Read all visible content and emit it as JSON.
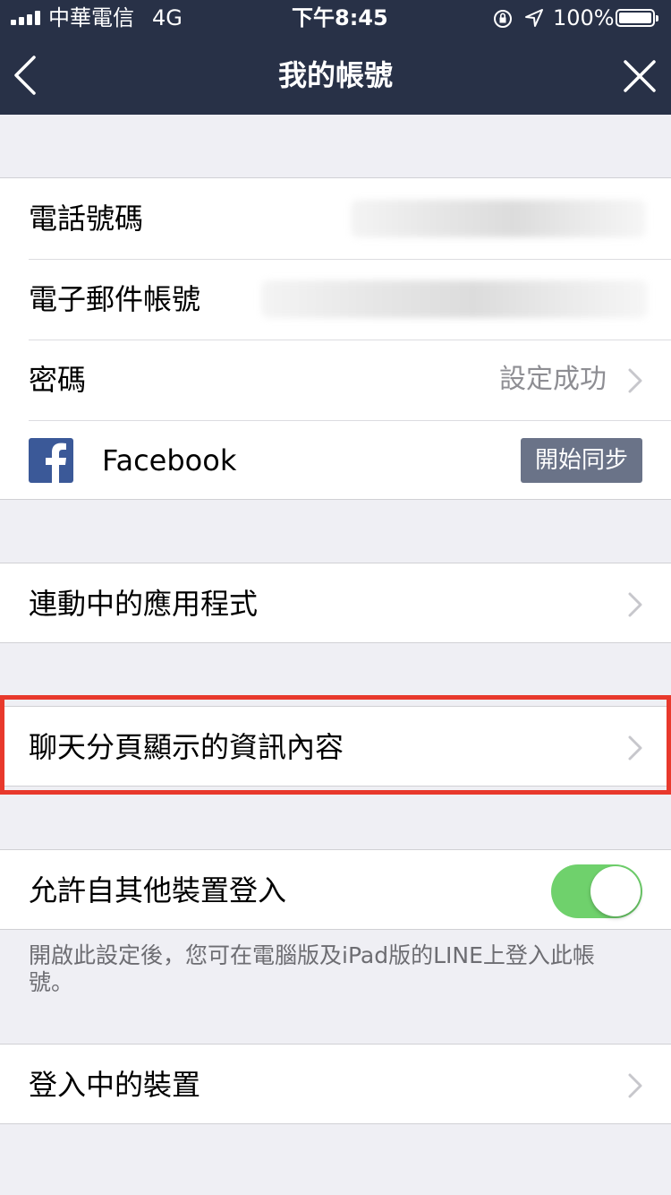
{
  "status_bar": {
    "carrier": "中華電信",
    "network": "4G",
    "time": "下午8:45",
    "battery": "100%",
    "battery_level_percent": 100,
    "icons": [
      "signal-icon",
      "orientation-lock-icon",
      "location-icon",
      "battery-icon"
    ]
  },
  "nav": {
    "title": "我的帳號",
    "back_icon": "chevron-left-icon",
    "close_icon": "close-icon"
  },
  "account": {
    "phone_label": "電話號碼",
    "email_label": "電子郵件帳號",
    "password_label": "密碼",
    "password_value": "設定成功",
    "facebook_label": "Facebook",
    "facebook_icon": "facebook-icon",
    "facebook_button": "開始同步"
  },
  "linked_apps": {
    "label": "連動中的應用程式"
  },
  "chat_tab_info": {
    "label": "聊天分頁顯示的資訊內容",
    "highlight_color": "#e8392c"
  },
  "other_devices": {
    "label": "允許自其他裝置登入",
    "toggle_on": true,
    "note": "開啟此設定後，您可在電腦版及iPad版的LINE上登入此帳號。"
  },
  "logged_in_devices": {
    "label": "登入中的裝置"
  },
  "colors": {
    "header_bg": "#283147",
    "toggle_on": "#6fd16c",
    "facebook_blue": "#3b5998",
    "sync_button_bg": "#6a7388"
  }
}
